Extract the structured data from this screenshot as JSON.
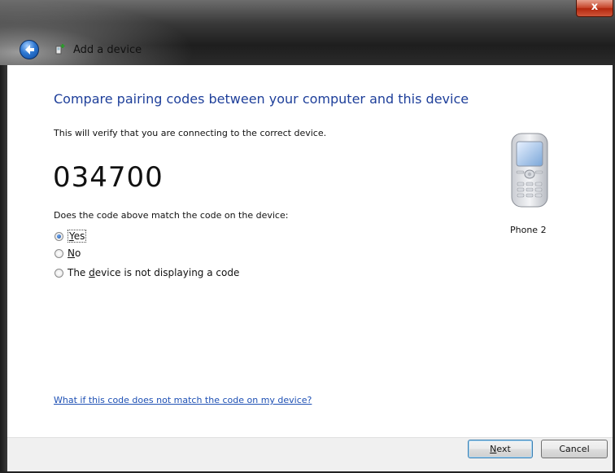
{
  "window": {
    "title": "Add a device",
    "close_label": "x"
  },
  "main": {
    "heading": "Compare pairing codes between your computer and this device",
    "description": "This will verify that you are connecting to the correct device.",
    "code": "034700",
    "question": "Does the code above match the code on the device:",
    "options": [
      {
        "pre": "",
        "accel": "Y",
        "post": "es",
        "checked": true
      },
      {
        "pre": "",
        "accel": "N",
        "post": "o",
        "checked": false
      },
      {
        "pre": "The ",
        "accel": "d",
        "post": "evice is not displaying a code",
        "checked": false
      }
    ],
    "device": {
      "label": "Phone 2",
      "icon": "mobile-phone-icon"
    },
    "help_link": "What if this code does not match the code on my device?"
  },
  "footer": {
    "next_label": "Next",
    "next_accel": "N",
    "next_rest": "ext",
    "cancel_label": "Cancel"
  },
  "colors": {
    "heading": "#1e3f9a",
    "link": "#1e50b4",
    "close_button": "#c6452b"
  }
}
